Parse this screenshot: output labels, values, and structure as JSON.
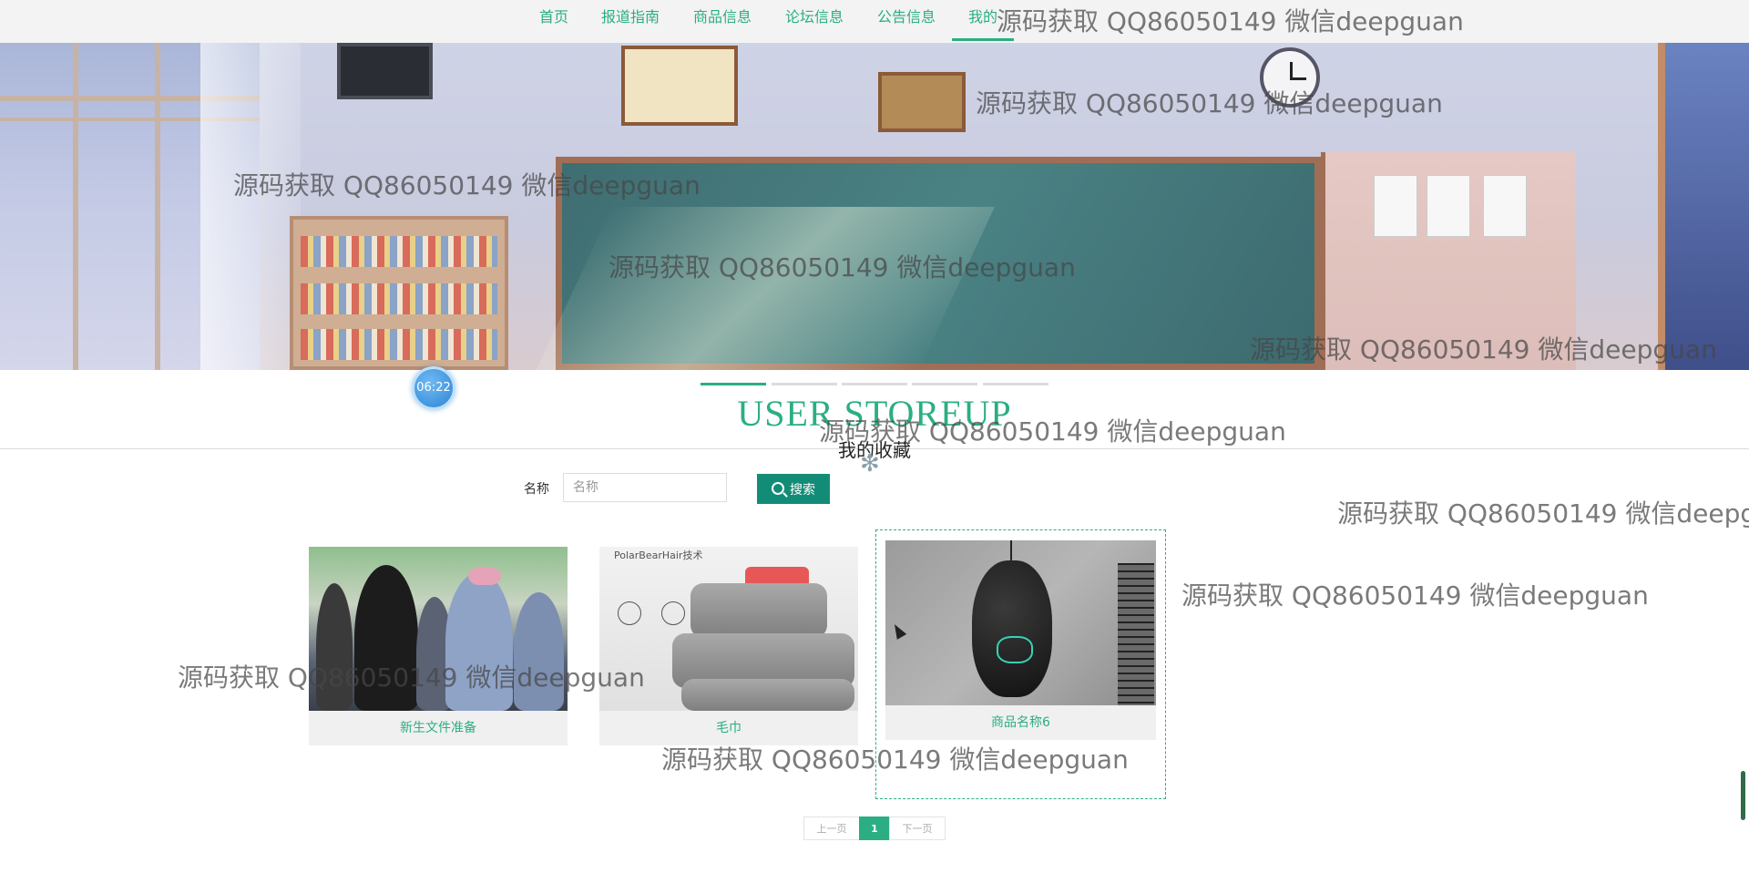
{
  "nav": {
    "items": [
      {
        "label": "首页"
      },
      {
        "label": "报道指南"
      },
      {
        "label": "商品信息"
      },
      {
        "label": "论坛信息"
      },
      {
        "label": "公告信息"
      },
      {
        "label": "我的"
      }
    ],
    "active_index": 5
  },
  "time_bubble": "06:22",
  "section": {
    "title": "USER STOREUP",
    "subtitle": "我的收藏"
  },
  "search": {
    "label": "名称",
    "placeholder": "名称",
    "value": "",
    "button_label": "搜索"
  },
  "cards": [
    {
      "title": "新生文件准备",
      "image": "students-photo"
    },
    {
      "title": "毛巾",
      "image": "towel-photo",
      "image_text": "PolarBearHair技术"
    },
    {
      "title": "商品名称6",
      "image": "gaming-mouse-photo"
    }
  ],
  "pagination": {
    "prev": "上一页",
    "current": "1",
    "next": "下一页"
  },
  "watermark": "源码获取 QQ86050149 微信deepguan",
  "colors": {
    "accent": "#2bae83",
    "button": "#138c77",
    "nav_bg": "#f3f3f3"
  }
}
